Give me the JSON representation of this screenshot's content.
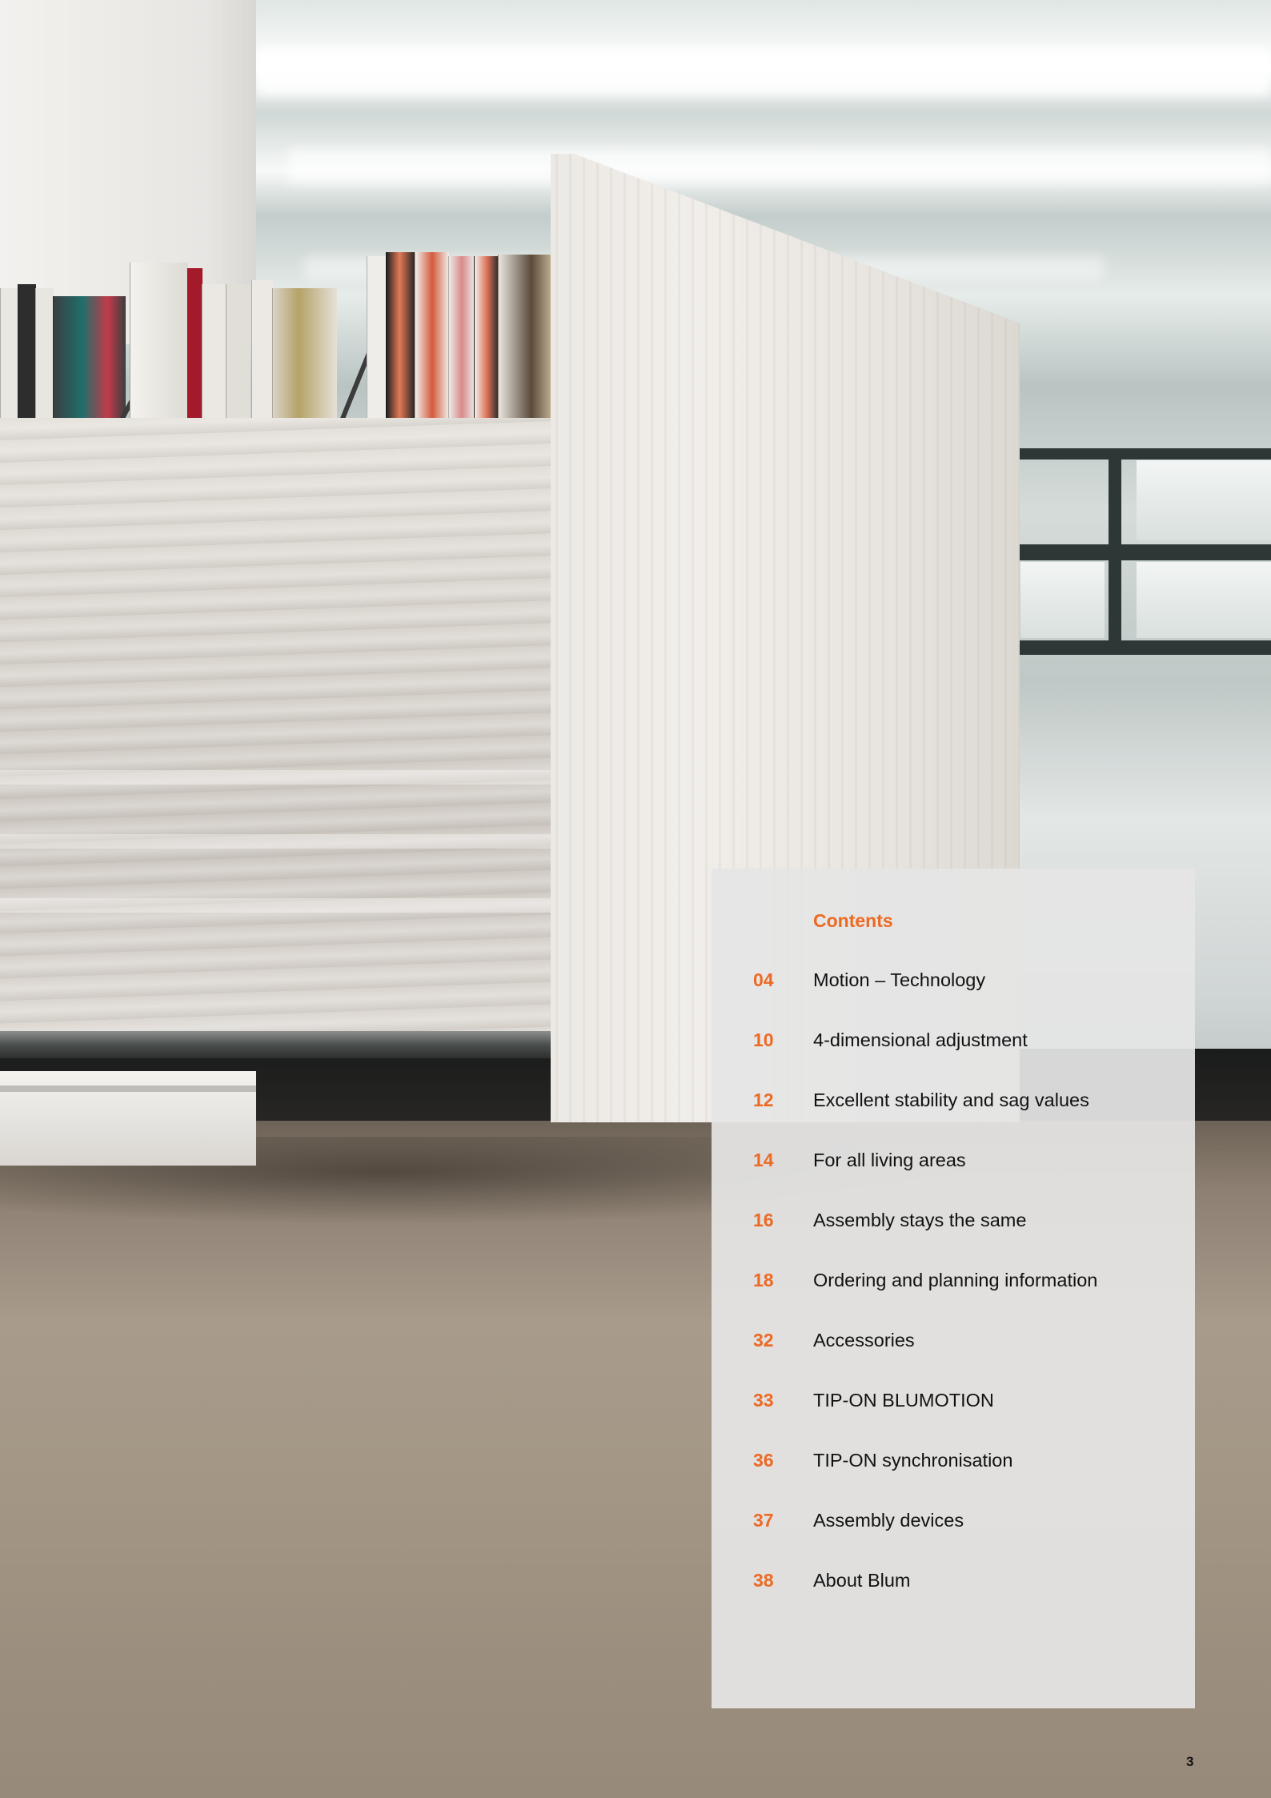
{
  "contents": {
    "title": "Contents",
    "entries": [
      {
        "page": "04",
        "label": "Motion – Technology"
      },
      {
        "page": "10",
        "label": "4-dimensional adjustment"
      },
      {
        "page": "12",
        "label": "Excellent stability and sag values"
      },
      {
        "page": "14",
        "label": "For all living areas"
      },
      {
        "page": "16",
        "label": "Assembly stays the same"
      },
      {
        "page": "18",
        "label": "Ordering and planning information"
      },
      {
        "page": "32",
        "label": "Accessories"
      },
      {
        "page": "33",
        "label": "TIP-ON BLUMOTION"
      },
      {
        "page": "36",
        "label": "TIP-ON synchronisation"
      },
      {
        "page": "37",
        "label": "Assembly devices"
      },
      {
        "page": "38",
        "label": "About Blum"
      }
    ]
  },
  "page_number": "3",
  "colors": {
    "accent": "#ec6a24",
    "panel": "#e5e5e5",
    "text": "#111111"
  }
}
